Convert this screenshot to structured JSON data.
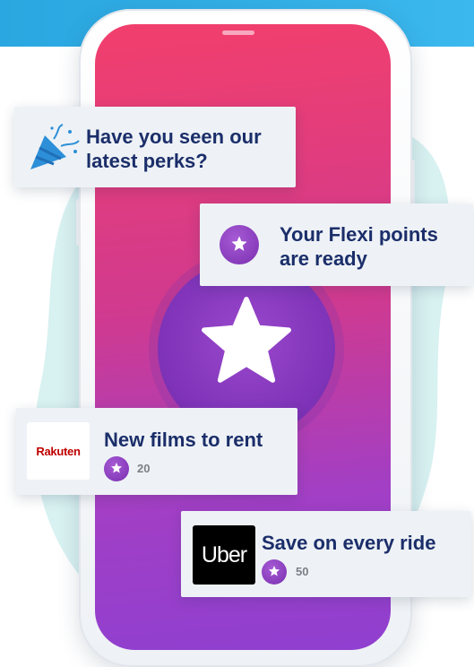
{
  "colors": {
    "accent_blue": "#2aa7e0",
    "title_navy": "#1b2e6a",
    "screen_top": "#f23f6c",
    "screen_bottom": "#8f3fd0",
    "star_purple": "#7a2fb0",
    "rakuten_red": "#bf0000"
  },
  "cards": {
    "perks": {
      "title": "Have you seen our latest perks?",
      "icon": "party-popper-icon"
    },
    "flexi": {
      "title": "Your Flexi points are ready",
      "icon": "star-badge-icon"
    },
    "rakuten": {
      "title": "New films to rent",
      "logo_text": "Rakuten",
      "points": "20"
    },
    "uber": {
      "title": "Save on every ride",
      "logo_text": "Uber",
      "points": "50"
    }
  }
}
